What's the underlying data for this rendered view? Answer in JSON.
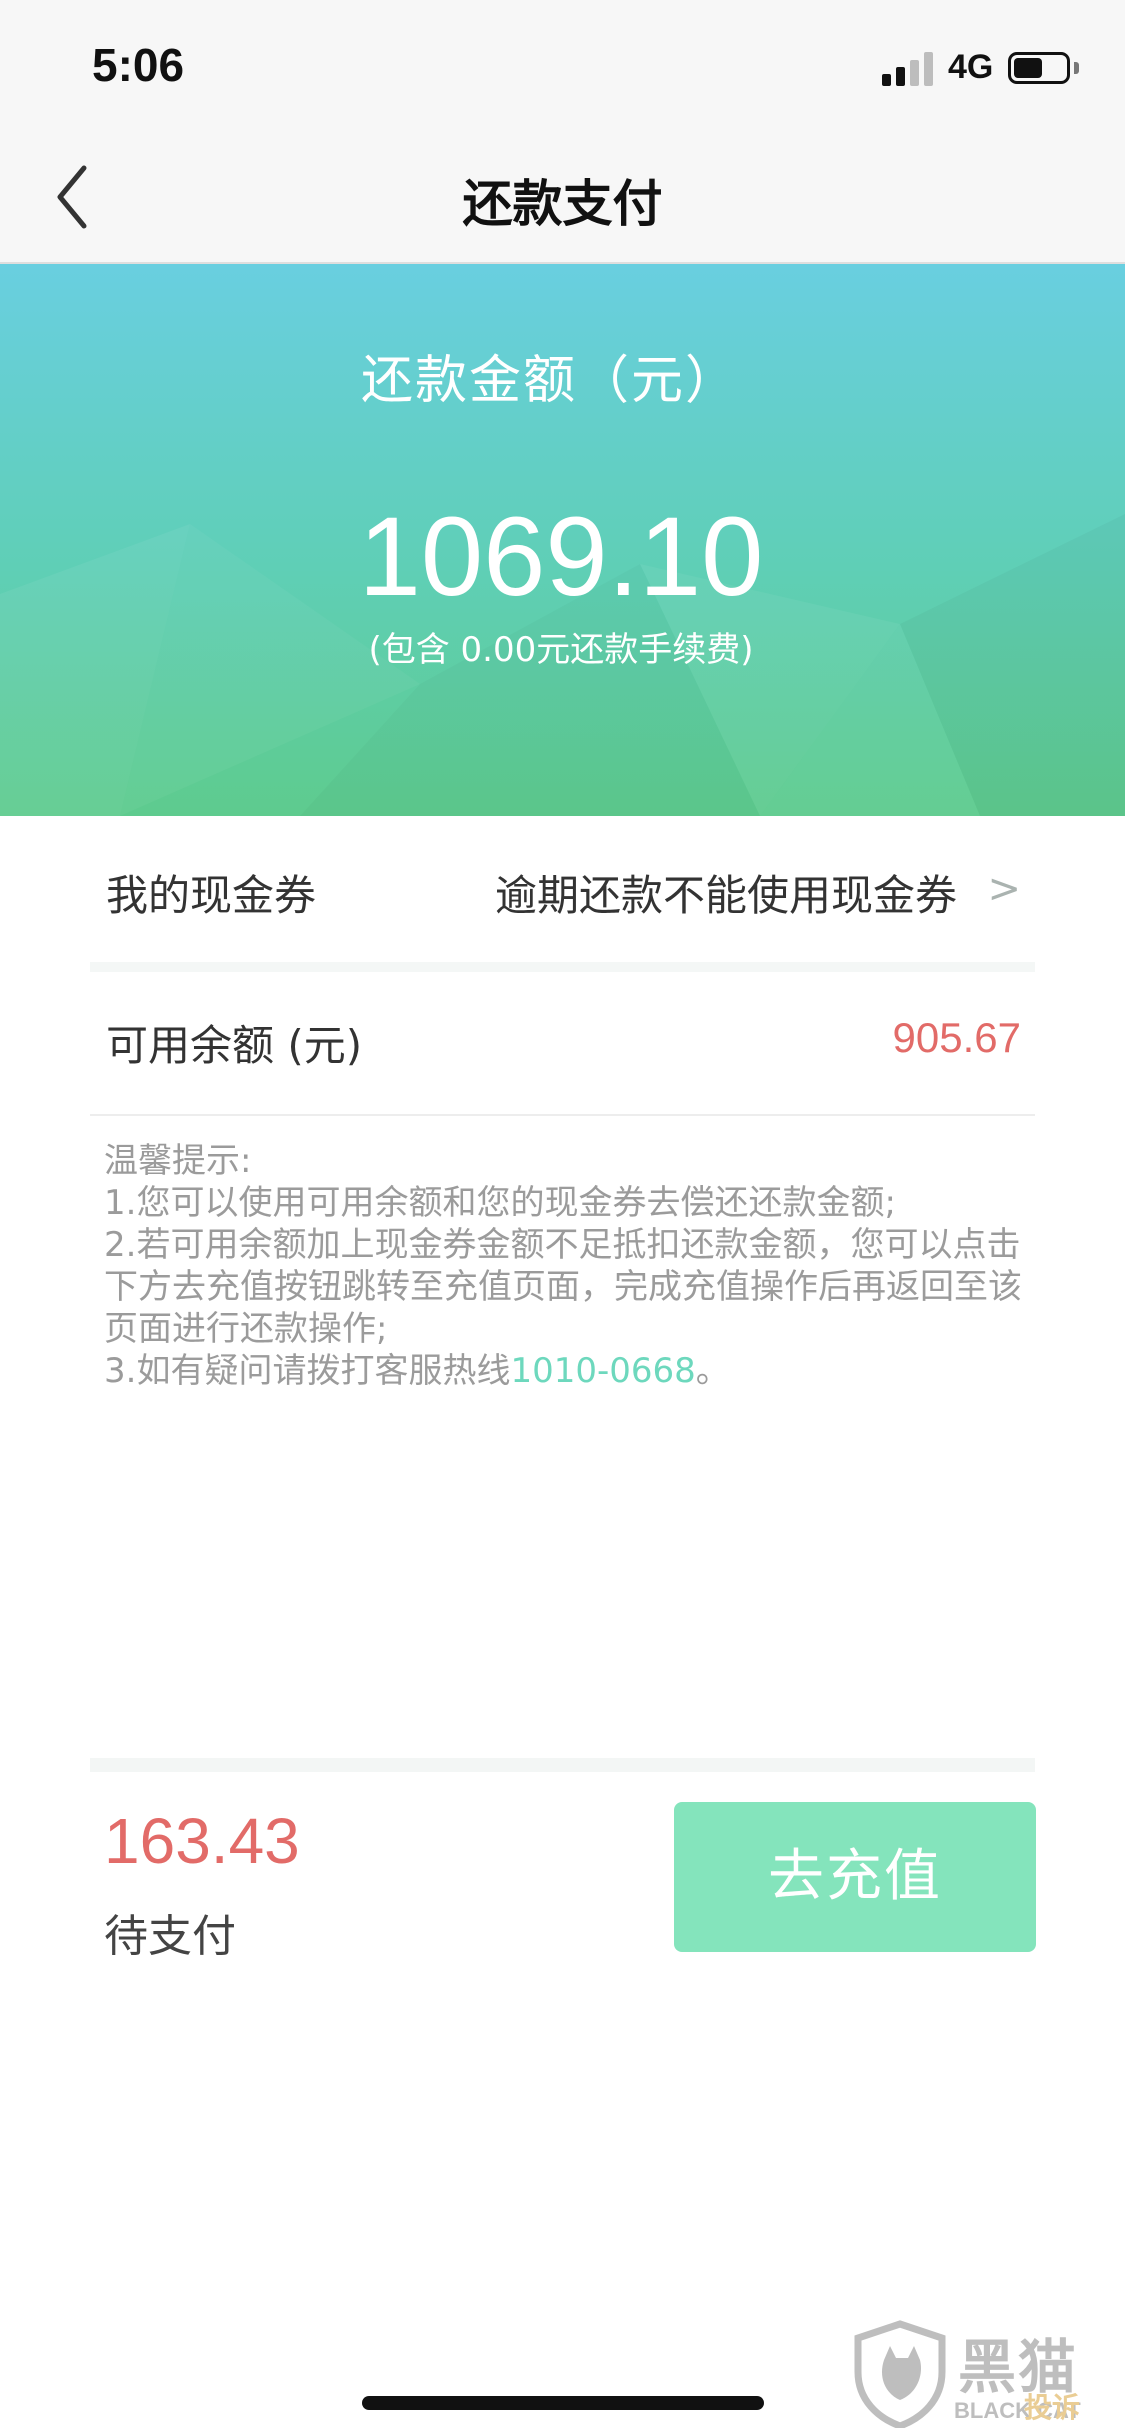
{
  "status_bar": {
    "time": "5:06",
    "network": "4G",
    "icons": [
      "signal-icon",
      "battery-icon"
    ]
  },
  "nav": {
    "title": "还款支付",
    "back_icon": "chevron-left-icon"
  },
  "hero": {
    "label": "还款金额（元）",
    "amount": "1069.10",
    "fee_note": "(包含 0.00元还款手续费)"
  },
  "coupon_row": {
    "label": "我的现金券",
    "value": "逾期还款不能使用现金券",
    "chevron": ">"
  },
  "balance_row": {
    "label": "可用余额 (元)",
    "value": "905.67"
  },
  "tips": {
    "title": "温馨提示:",
    "line1": "1.您可以使用可用余额和您的现金券去偿还还款金额;",
    "line2": "2.若可用余额加上现金券金额不足抵扣还款金额，您可以点击下方去充值按钮跳转至充值页面，完成充值操作后再返回至该页面进行还款操作;",
    "line3_prefix": "3.如有疑问请拨打客服热线",
    "hotline": "1010-0668",
    "line3_suffix": "。"
  },
  "pay_bar": {
    "amount": "163.43",
    "label": "待支付",
    "button_label": "去充值"
  },
  "watermark": {
    "text": "黑猫",
    "sub": "BLACK CAT",
    "tag": "投诉"
  },
  "colors": {
    "accent_red": "#e26b68",
    "button_green": "#84e4bc",
    "hotline_green": "#6dd8bd",
    "hero_top": "#69cfe0",
    "hero_bottom": "#5ecb8e"
  }
}
